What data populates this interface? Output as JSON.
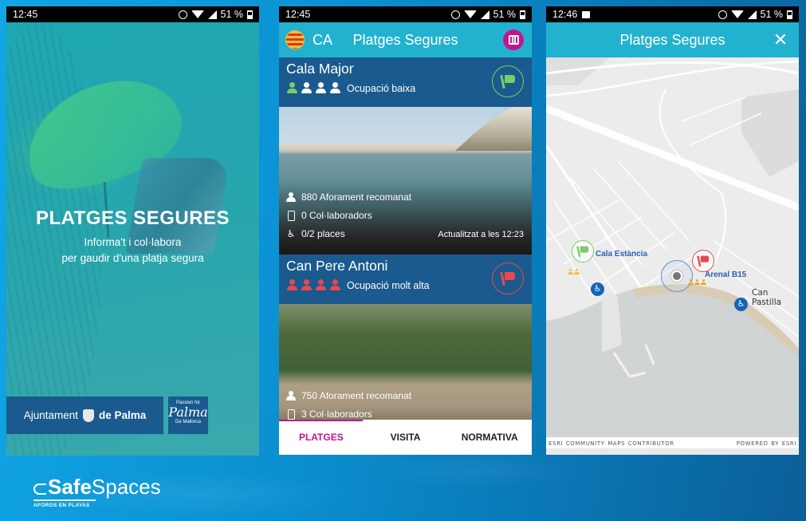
{
  "status_bars": [
    {
      "time": "12:45",
      "battery": "51 %",
      "extra_icon": null
    },
    {
      "time": "12:45",
      "battery": "51 %",
      "extra_icon": null
    },
    {
      "time": "12:46",
      "battery": "51 %",
      "extra_icon": "image-icon"
    }
  ],
  "splash": {
    "title": "PLATGES SEGURES",
    "subtitle_line1": "Informa't i col·labora",
    "subtitle_line2": "per gaudir d'una platja segura",
    "sponsor_left_prefix": "Ajuntament",
    "sponsor_left_bold": "de Palma",
    "sponsor_right_line1": "Passion for",
    "sponsor_right_line2": "Palma",
    "sponsor_right_line3": "De Mallorca"
  },
  "list_screen": {
    "language": "CA",
    "title": "Platges Segures",
    "beaches": [
      {
        "name": "Cala Major",
        "occupancy": "Ocupació baixa",
        "occupancy_level": 1,
        "occupancy_max": 4,
        "flag": "green",
        "capacity": "880 Aforament recomanat",
        "collaborators": "0 Col·laboradors",
        "accessible_places": "0/2 places",
        "updated": "Actualitzat a les 12:23"
      },
      {
        "name": "Can Pere Antoni",
        "occupancy": "Ocupació molt alta",
        "occupancy_level": 4,
        "occupancy_max": 4,
        "flag": "red",
        "capacity": "750 Aforament recomanat",
        "collaborators": "3 Col·laboradors"
      }
    ],
    "nav": [
      {
        "label": "PLATGES",
        "active": true
      },
      {
        "label": "VISITA",
        "active": false
      },
      {
        "label": "NORMATIVA",
        "active": false
      }
    ]
  },
  "map_screen": {
    "title": "Platges Segures",
    "markers": [
      {
        "name": "Cala Estància",
        "flag": "green"
      },
      {
        "name": "Arenal B15",
        "flag": "red"
      }
    ],
    "place_label": "Can Pastilla",
    "attribution_left": "Esri Community Maps Contributor",
    "attribution_right": "Powered by Esri"
  },
  "brand": {
    "logo_bold": "Safe",
    "logo_regular": "Spaces",
    "logo_tagline": "AFOROS EN PLAYAS"
  },
  "colors": {
    "appbar": "#22b2cf",
    "card_header": "#1a5a8e",
    "accent": "#c2168c",
    "flag_green": "#7ccb6a",
    "flag_red": "#e8494e",
    "occupancy_inactive": "#ffffff"
  }
}
